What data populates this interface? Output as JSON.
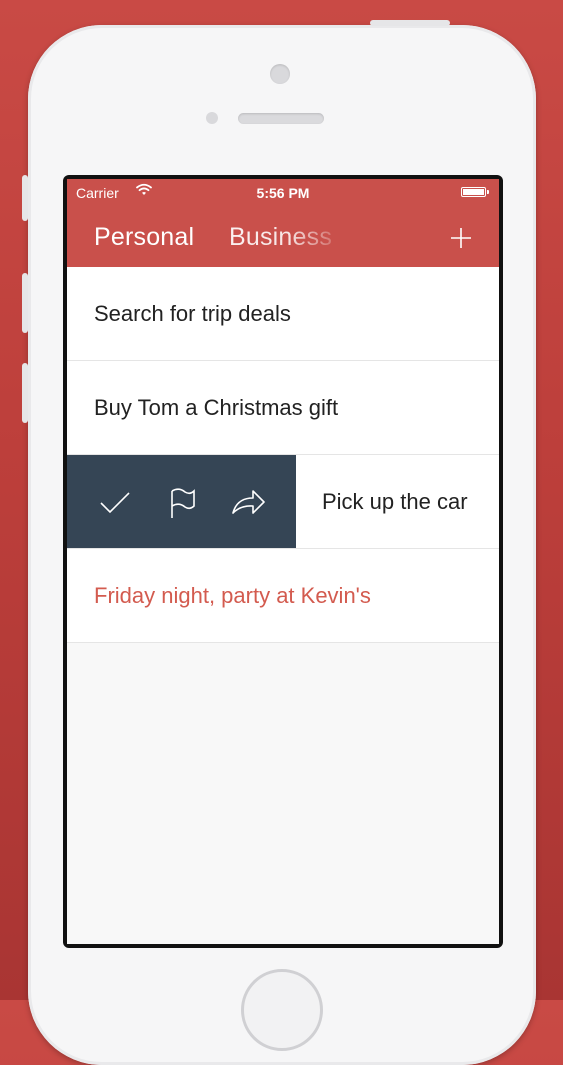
{
  "status_bar": {
    "carrier": "Carrier",
    "time": "5:56 PM"
  },
  "header": {
    "tabs": [
      {
        "label": "Personal"
      },
      {
        "label": "Business"
      }
    ],
    "add_icon": "plus-icon"
  },
  "tasks": [
    {
      "text": "Search for trip deals"
    },
    {
      "text": "Buy Tom a Christmas gift"
    },
    {
      "text": "Pick up the car",
      "swiped": true,
      "actions": [
        "check-icon",
        "flag-icon",
        "forward-icon"
      ]
    },
    {
      "text": "Friday night, party at Kevin's",
      "highlighted": true
    }
  ],
  "colors": {
    "background": "#bd3f3b",
    "header": "#c9504b",
    "swipe_actions": "#354555",
    "highlight_text": "#d35b4f"
  }
}
